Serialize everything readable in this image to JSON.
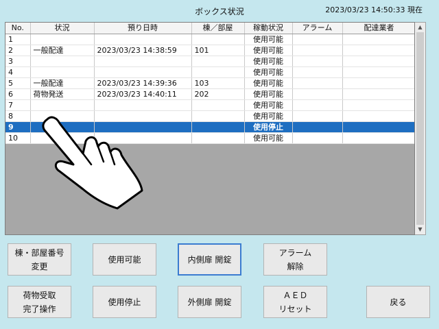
{
  "header": {
    "title": "ボックス状況",
    "datetime": "2023/03/23 14:50:33 現在"
  },
  "table": {
    "columns": [
      "No.",
      "状況",
      "預り日時",
      "棟／部屋",
      "稼動状況",
      "アラーム",
      "配達業者"
    ],
    "rows": [
      [
        "1",
        "",
        "",
        "",
        "使用可能",
        "",
        ""
      ],
      [
        "2",
        "一般配達",
        "2023/03/23 14:38:59",
        "101",
        "使用可能",
        "",
        ""
      ],
      [
        "3",
        "",
        "",
        "",
        "使用可能",
        "",
        ""
      ],
      [
        "4",
        "",
        "",
        "",
        "使用可能",
        "",
        ""
      ],
      [
        "5",
        "一般配達",
        "2023/03/23 14:39:36",
        "103",
        "使用可能",
        "",
        ""
      ],
      [
        "6",
        "荷物発送",
        "2023/03/23 14:40:11",
        "202",
        "使用可能",
        "",
        ""
      ],
      [
        "7",
        "",
        "",
        "",
        "使用可能",
        "",
        ""
      ],
      [
        "8",
        "",
        "",
        "",
        "使用可能",
        "",
        ""
      ],
      [
        "9",
        "",
        "",
        "",
        "使用停止",
        "",
        ""
      ],
      [
        "10",
        "",
        "",
        "",
        "使用可能",
        "",
        ""
      ]
    ],
    "selected_row": 8
  },
  "buttons": {
    "room_change": "棟・部屋番号\n変更",
    "enable": "使用可能",
    "inner_door": "内側扉 開錠",
    "alarm_reset": "アラーム\n解除",
    "receive_complete": "荷物受取\n完了操作",
    "disable": "使用停止",
    "outer_door": "外側扉 開錠",
    "aed_reset": "ＡＥＤ\nリセット",
    "back": "戻る"
  },
  "colors": {
    "background": "#c5e7ee",
    "selected_row": "#1e6ec1",
    "empty_area": "#a7a7a7"
  },
  "icons": {
    "pointer": "hand-pointer-icon"
  }
}
